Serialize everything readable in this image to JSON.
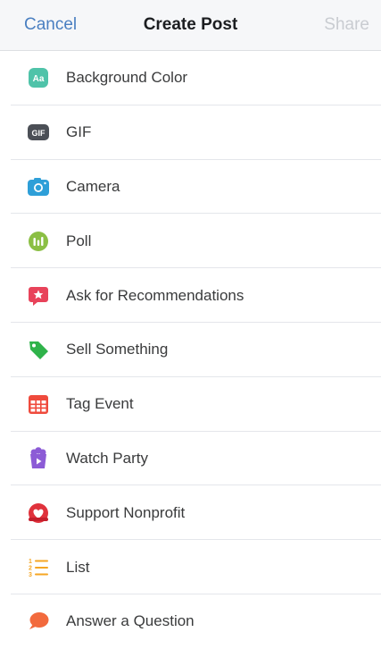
{
  "header": {
    "cancel_label": "Cancel",
    "title": "Create Post",
    "share_label": "Share"
  },
  "items": [
    {
      "label": "Background Color",
      "icon": "background-color-icon",
      "color": "#4fc3a9"
    },
    {
      "label": "GIF",
      "icon": "gif-icon",
      "color": "#4b4f56"
    },
    {
      "label": "Camera",
      "icon": "camera-icon",
      "color": "#2e9fd8"
    },
    {
      "label": "Poll",
      "icon": "poll-icon",
      "color": "#8bbf44"
    },
    {
      "label": "Ask for Recommendations",
      "icon": "recommendations-icon",
      "color": "#e8435a"
    },
    {
      "label": "Sell Something",
      "icon": "price-tag-icon",
      "color": "#2fb34a"
    },
    {
      "label": "Tag Event",
      "icon": "calendar-icon",
      "color": "#ef4a3c"
    },
    {
      "label": "Watch Party",
      "icon": "popcorn-icon",
      "color": "#8c5bd6"
    },
    {
      "label": "Support Nonprofit",
      "icon": "nonprofit-heart-icon",
      "color": "#e0323c"
    },
    {
      "label": "List",
      "icon": "numbered-list-icon",
      "color": "#f5a623"
    },
    {
      "label": "Answer a Question",
      "icon": "speech-bubble-icon",
      "color": "#f26a3d"
    }
  ]
}
